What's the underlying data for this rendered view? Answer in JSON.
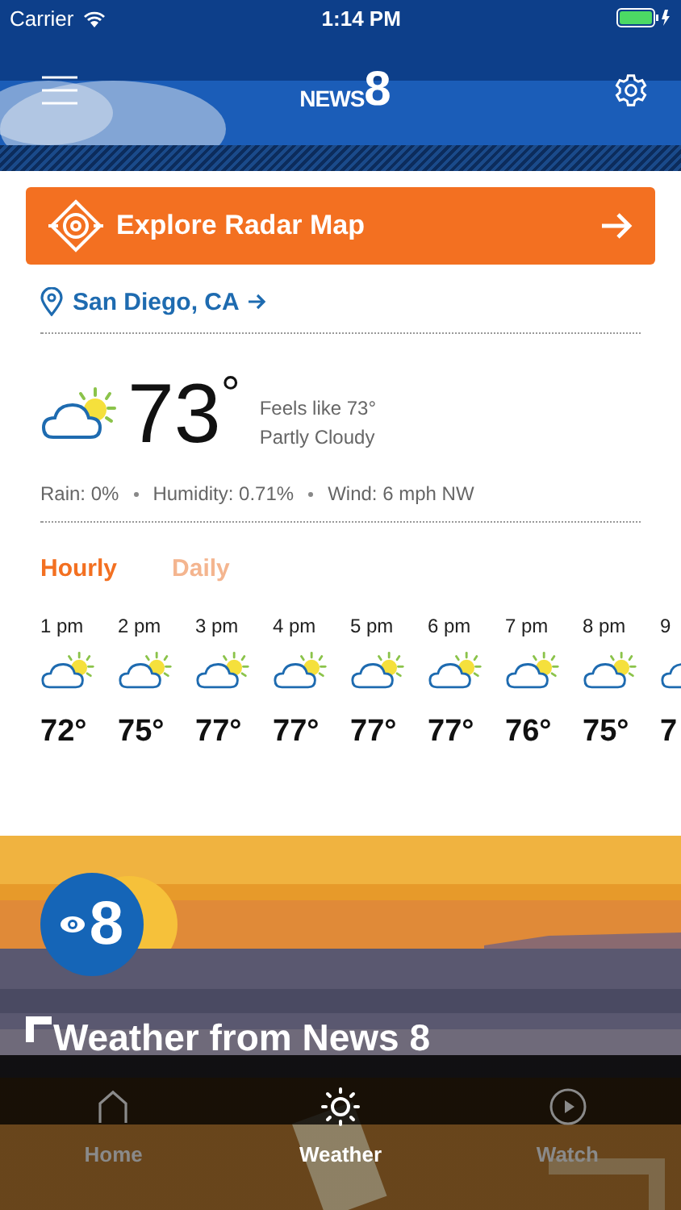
{
  "status_bar": {
    "carrier": "Carrier",
    "time": "1:14 PM"
  },
  "header": {
    "logo": {
      "text": "NEWS",
      "numeral": "8"
    }
  },
  "radar_button": {
    "label": "Explore Radar Map"
  },
  "location": {
    "label": "San Diego, CA"
  },
  "current": {
    "temperature": "73",
    "unit": "°",
    "feels_like": "Feels like 73°",
    "condition": "Partly Cloudy"
  },
  "details": [
    "Rain: 0%",
    "Humidity: 0.71%",
    "Wind: 6 mph NW"
  ],
  "forecast_tabs": [
    {
      "label": "Hourly",
      "selected": true
    },
    {
      "label": "Daily",
      "selected": false
    }
  ],
  "hourly": [
    {
      "time": "1 pm",
      "temp": "72°"
    },
    {
      "time": "2 pm",
      "temp": "75°"
    },
    {
      "time": "3 pm",
      "temp": "77°"
    },
    {
      "time": "4 pm",
      "temp": "77°"
    },
    {
      "time": "5 pm",
      "temp": "77°"
    },
    {
      "time": "6 pm",
      "temp": "77°"
    },
    {
      "time": "7 pm",
      "temp": "76°"
    },
    {
      "time": "8 pm",
      "temp": "75°"
    },
    {
      "time": "9",
      "temp": "7"
    }
  ],
  "story": {
    "badge": "8",
    "title": "Weather from News 8"
  },
  "tab_bar": [
    {
      "label": "Home",
      "kind": "home",
      "selected": false
    },
    {
      "label": "Weather",
      "kind": "sun",
      "selected": true
    },
    {
      "label": "Watch",
      "kind": "play",
      "selected": false
    }
  ]
}
